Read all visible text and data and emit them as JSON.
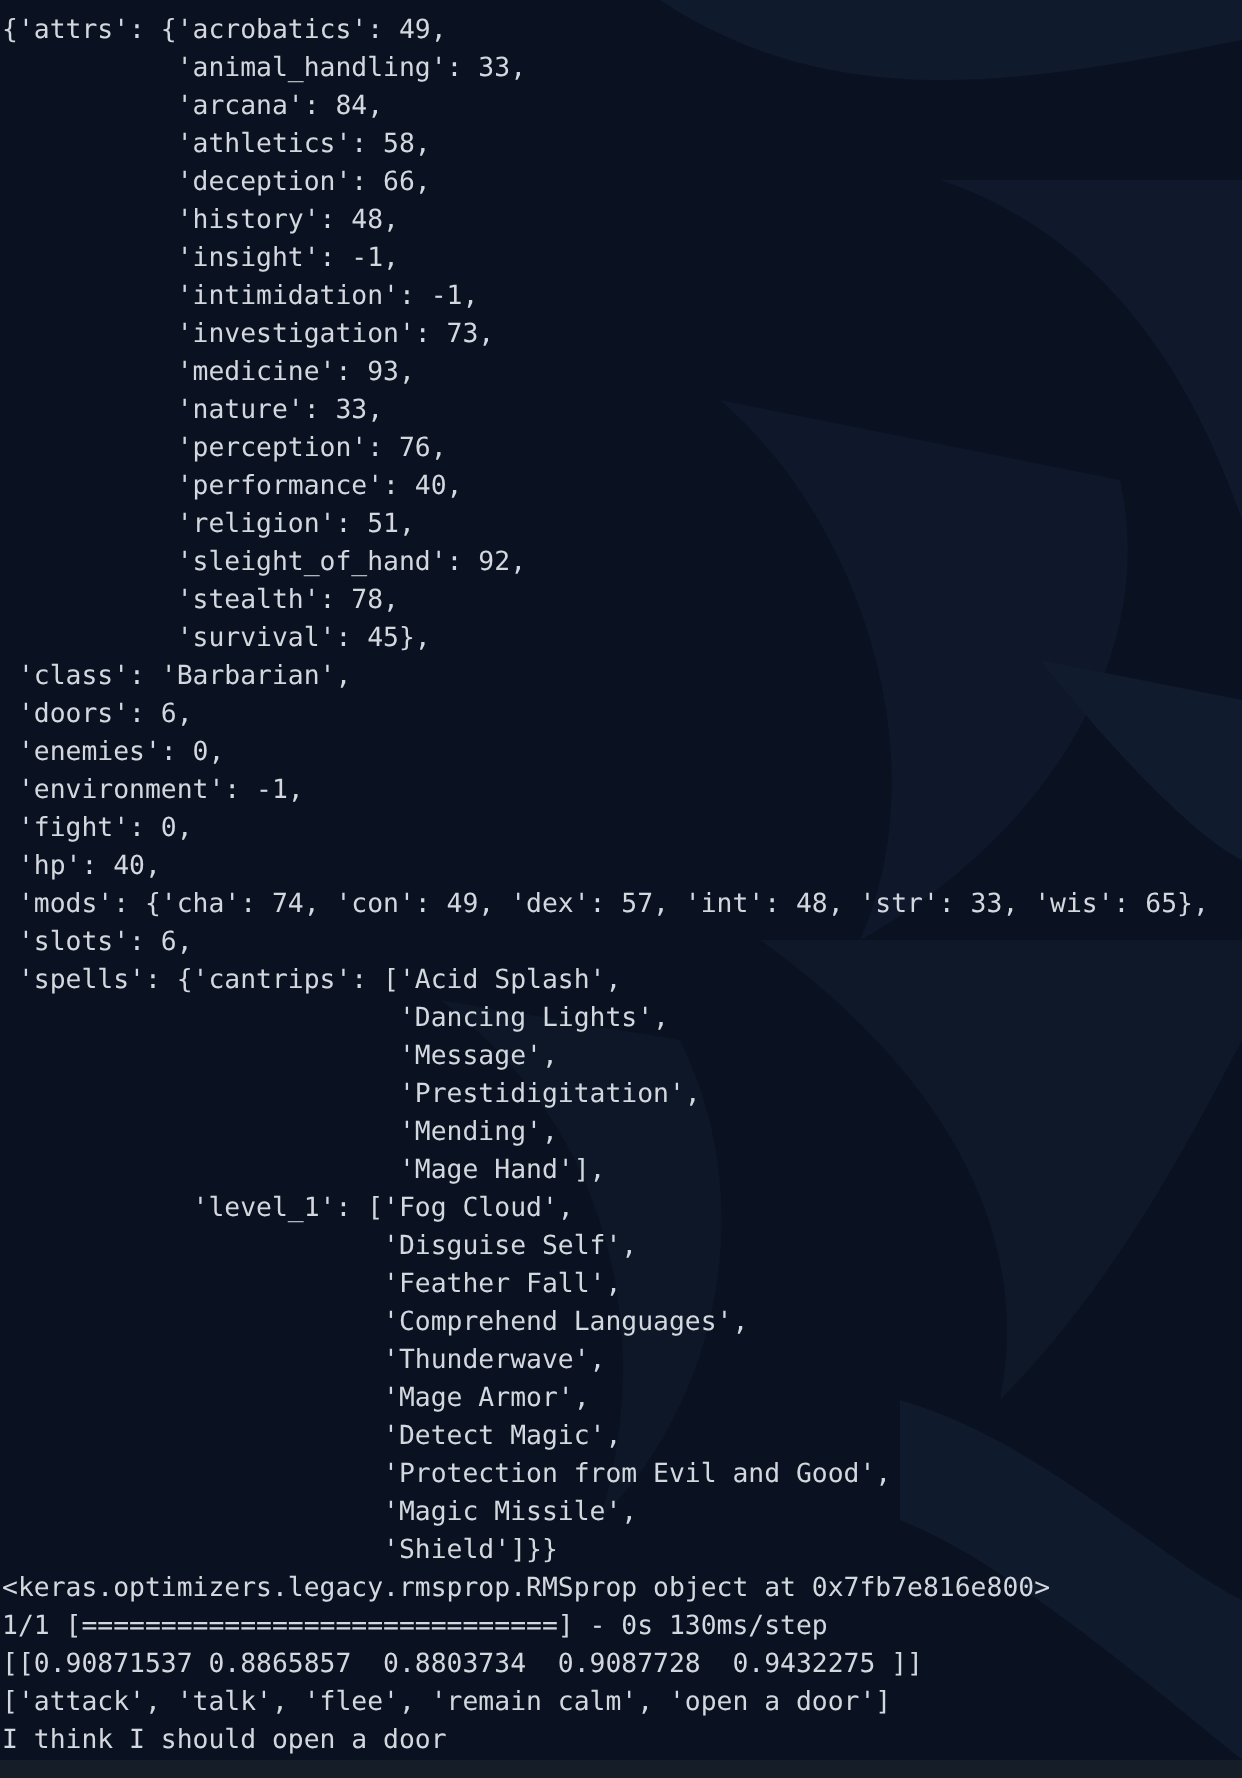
{
  "terminal": {
    "lines": [
      "{'attrs': {'acrobatics': 49,",
      "           'animal_handling': 33,",
      "           'arcana': 84,",
      "           'athletics': 58,",
      "           'deception': 66,",
      "           'history': 48,",
      "           'insight': -1,",
      "           'intimidation': -1,",
      "           'investigation': 73,",
      "           'medicine': 93,",
      "           'nature': 33,",
      "           'perception': 76,",
      "           'performance': 40,",
      "           'religion': 51,",
      "           'sleight_of_hand': 92,",
      "           'stealth': 78,",
      "           'survival': 45},",
      " 'class': 'Barbarian',",
      " 'doors': 6,",
      " 'enemies': 0,",
      " 'environment': -1,",
      " 'fight': 0,",
      " 'hp': 40,",
      " 'mods': {'cha': 74, 'con': 49, 'dex': 57, 'int': 48, 'str': 33, 'wis': 65},",
      " 'slots': 6,",
      " 'spells': {'cantrips': ['Acid Splash',",
      "                         'Dancing Lights',",
      "                         'Message',",
      "                         'Prestidigitation',",
      "                         'Mending',",
      "                         'Mage Hand'],",
      "            'level_1': ['Fog Cloud',",
      "                        'Disguise Self',",
      "                        'Feather Fall',",
      "                        'Comprehend Languages',",
      "                        'Thunderwave',",
      "                        'Mage Armor',",
      "                        'Detect Magic',",
      "                        'Protection from Evil and Good',",
      "                        'Magic Missile',",
      "                        'Shield']}}",
      "<keras.optimizers.legacy.rmsprop.RMSprop object at 0x7fb7e816e800>",
      "1/1 [==============================] - 0s 130ms/step",
      "[[0.90871537 0.8865857  0.8803734  0.9087728  0.9432275 ]]",
      "['attack', 'talk', 'flee', 'remain calm', 'open a door']",
      "I think I should open a door"
    ]
  }
}
